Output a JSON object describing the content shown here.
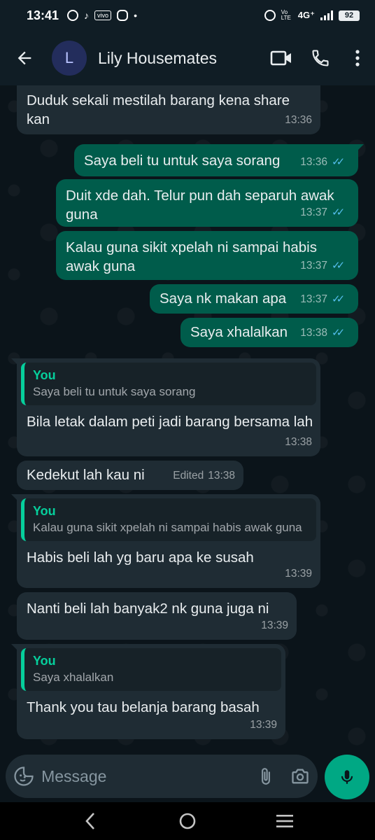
{
  "status_bar": {
    "time": "13:41",
    "network": "4G⁺",
    "volte": "Vo LTE",
    "battery": "92",
    "dot": "•"
  },
  "header": {
    "avatar_letter": "L",
    "title": "Lily Housemates"
  },
  "messages": [
    {
      "dir": "in",
      "text": "Duduk sekali mestilah barang kena share kan",
      "time": "13:36"
    },
    {
      "dir": "out",
      "text": "Saya beli tu untuk saya sorang",
      "time": "13:36"
    },
    {
      "dir": "out",
      "text": "Duit xde dah. Telur pun dah separuh awak guna",
      "time": "13:37"
    },
    {
      "dir": "out",
      "text": "Kalau guna sikit xpelah ni sampai habis awak guna",
      "time": "13:37"
    },
    {
      "dir": "out",
      "text": "Saya nk makan apa",
      "time": "13:37"
    },
    {
      "dir": "out",
      "text": "Saya xhalalkan",
      "time": "13:38"
    },
    {
      "dir": "in",
      "quote_author": "You",
      "quote_text": "Saya beli tu untuk saya sorang",
      "text": "Bila letak dalam peti jadi barang bersama lah",
      "time": "13:38"
    },
    {
      "dir": "in",
      "text": "Kedekut lah kau ni",
      "edited": "Edited",
      "time": "13:38"
    },
    {
      "dir": "in",
      "quote_author": "You",
      "quote_text": "Kalau guna sikit xpelah ni sampai habis awak guna",
      "text": "Habis beli lah yg baru apa ke susah",
      "time": "13:39"
    },
    {
      "dir": "in",
      "text": "Nanti beli lah banyak2 nk guna juga ni",
      "time": "13:39"
    },
    {
      "dir": "in",
      "quote_author": "You",
      "quote_text": "Saya xhalalkan",
      "text": "Thank you tau belanja barang basah",
      "time": "13:39"
    }
  ],
  "composer": {
    "placeholder": "Message"
  },
  "colors": {
    "incoming_bubble": "#1f2c34",
    "outgoing_bubble": "#005c4b",
    "accent": "#00a884",
    "read_ticks": "#53bdeb",
    "quote_bar": "#06cf9c"
  }
}
